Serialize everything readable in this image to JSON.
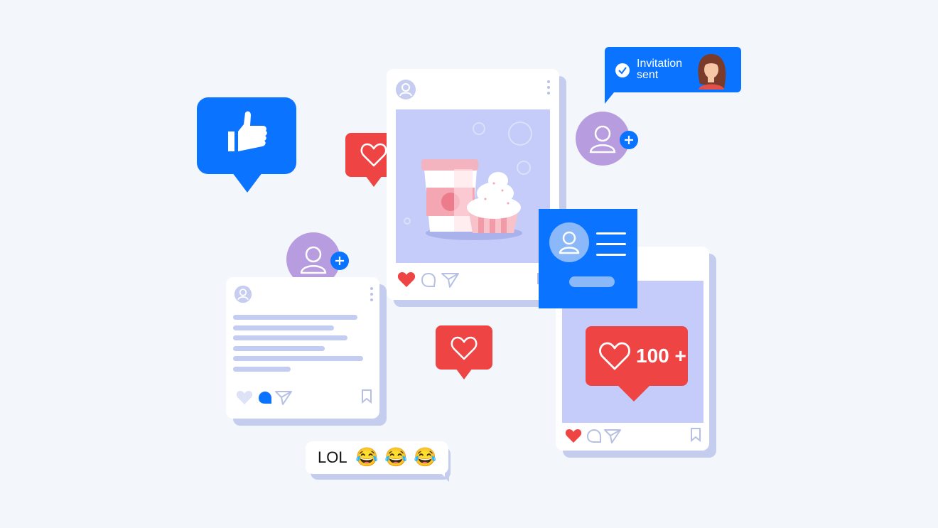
{
  "invitation": {
    "text_line1": "Invitation",
    "text_line2": "sent"
  },
  "notification": {
    "count": "100 +"
  },
  "lol_bubble": {
    "text": "LOL",
    "emojis": [
      "😂",
      "😂",
      "😂"
    ]
  },
  "icons": {
    "like": "thumbs-up-icon",
    "heart": "heart-icon",
    "comment": "comment-icon",
    "share": "send-icon",
    "bookmark": "bookmark-icon",
    "add_user": "add-user-icon",
    "check": "check-icon"
  },
  "colors": {
    "background": "#f3f7fc",
    "brand_blue": "#0a73ff",
    "heart_red": "#ef4444",
    "avatar_purple": "#b79ddf",
    "image_lavender": "#c5ccf9",
    "card_shadow": "#c5cdef"
  }
}
